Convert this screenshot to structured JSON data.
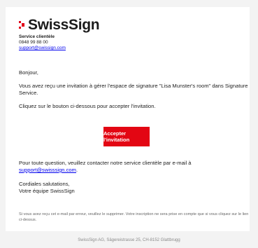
{
  "brand": {
    "name": "SwissSign",
    "accent": "#e2001a"
  },
  "contact": {
    "label": "Service clientèle",
    "phone": "0848 99 88 00",
    "email": "support@swissign.com"
  },
  "email": {
    "greeting": "Bonjour,",
    "intro": "Vous avez reçu une invitation à gérer l'espace de signature \"Lisa Munster's room\" dans Signature Service.",
    "instruction": "Cliquez sur le bouton ci-dessous pour accepter l'invitation.",
    "button_label": "Accepter l'invitation",
    "questions_text": "Pour toute question, veuillez contacter notre service clientèle par e-mail à",
    "questions_email": "support@swisssign.com",
    "questions_suffix": ".",
    "closing": "Cordiales salutations,",
    "signature": "Votre équipe SwissSign",
    "disclaimer": "Si vous avez reçu cet e-mail par erreur, veuillez le supprimer. Votre inscription ne sera prise en compte que si vous cliquez sur le lien ci-dessus."
  },
  "footer": {
    "address": "SwissSign AG, Sägereistrasse 25, CH-8152 Glattbrugg"
  }
}
